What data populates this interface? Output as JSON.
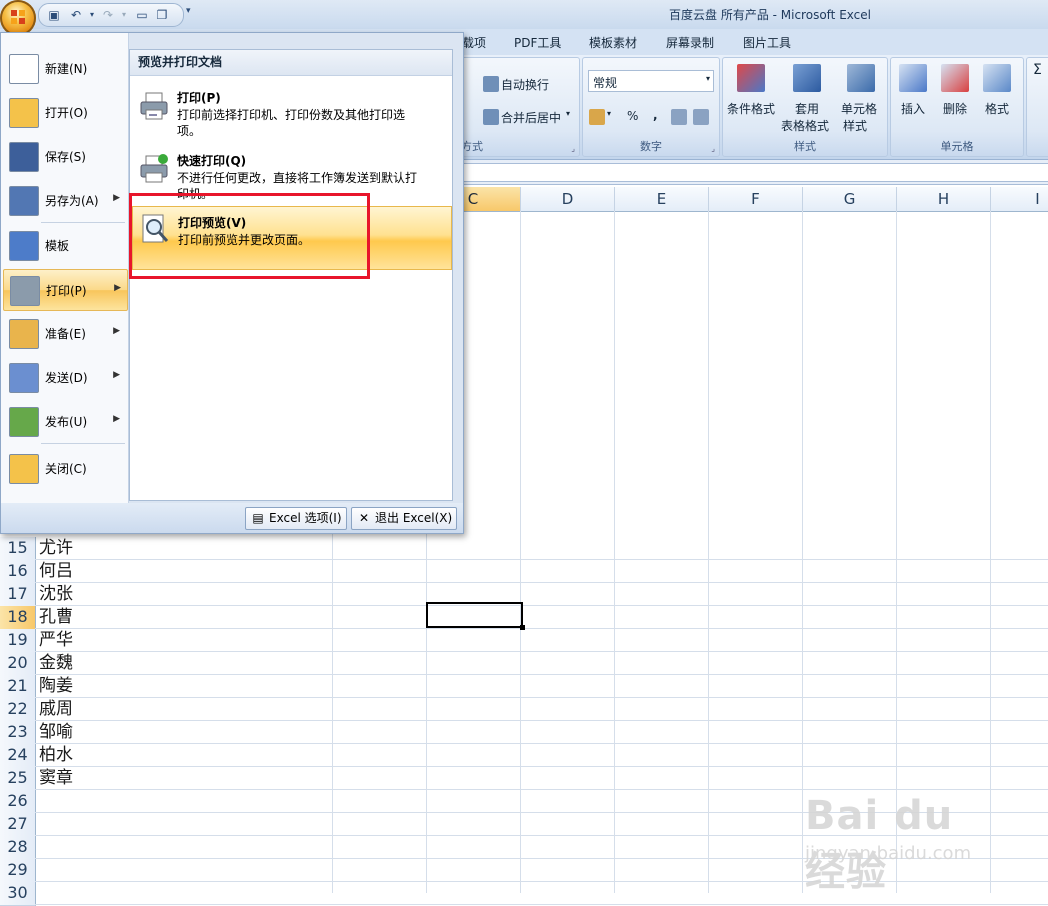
{
  "window": {
    "title": "百度云盘 所有产品 - Microsoft Excel"
  },
  "tabs": [
    "载项",
    "PDF工具",
    "模板素材",
    "屏幕录制",
    "图片工具"
  ],
  "ribbon": {
    "alignment": {
      "wrap_text": "自动换行",
      "merge_center": "合并后居中",
      "group_label": "方式"
    },
    "number": {
      "format_value": "常规",
      "percent": "%",
      "comma": ",",
      "group_label": "数字"
    },
    "styles": {
      "conditional": "条件格式",
      "table_fmt_1": "套用",
      "table_fmt_2": "表格格式",
      "cell_style_1": "单元格",
      "cell_style_2": "样式",
      "group_label": "样式"
    },
    "cells": {
      "insert": "插入",
      "delete": "删除",
      "format": "格式",
      "group_label": "单元格"
    }
  },
  "columns": [
    "C",
    "D",
    "E",
    "F",
    "G",
    "H",
    "I"
  ],
  "selected_column": "C",
  "rows": [
    {
      "num": "15",
      "name": "尤许"
    },
    {
      "num": "16",
      "name": "何吕"
    },
    {
      "num": "17",
      "name": "沈张"
    },
    {
      "num": "18",
      "name": "孔曹"
    },
    {
      "num": "19",
      "name": "严华"
    },
    {
      "num": "20",
      "name": "金魏"
    },
    {
      "num": "21",
      "name": "陶姜"
    },
    {
      "num": "22",
      "name": "戚周"
    },
    {
      "num": "23",
      "name": "邹喻"
    },
    {
      "num": "24",
      "name": "柏水"
    },
    {
      "num": "25",
      "name": "窦章"
    },
    {
      "num": "26",
      "name": ""
    },
    {
      "num": "27",
      "name": ""
    },
    {
      "num": "28",
      "name": ""
    },
    {
      "num": "29",
      "name": ""
    },
    {
      "num": "30",
      "name": ""
    }
  ],
  "selected_row": "18",
  "menu": {
    "items": [
      {
        "label": "新建(N)",
        "icon": "new-document-icon",
        "arrow": false
      },
      {
        "label": "打开(O)",
        "icon": "open-folder-icon",
        "arrow": false
      },
      {
        "label": "保存(S)",
        "icon": "save-disk-icon",
        "arrow": false
      },
      {
        "label": "另存为(A)",
        "icon": "save-as-icon",
        "arrow": true
      },
      {
        "label": "模板",
        "icon": "template-icon",
        "arrow": false
      },
      {
        "label": "打印(P)",
        "icon": "printer-icon",
        "arrow": true
      },
      {
        "label": "准备(E)",
        "icon": "prepare-pen-icon",
        "arrow": true
      },
      {
        "label": "发送(D)",
        "icon": "send-icon",
        "arrow": true
      },
      {
        "label": "发布(U)",
        "icon": "publish-icon",
        "arrow": true
      },
      {
        "label": "关闭(C)",
        "icon": "close-folder-icon",
        "arrow": false
      }
    ],
    "selected": "打印(P)",
    "submenu": {
      "header": "预览并打印文档",
      "items": [
        {
          "title": "打印(P)",
          "desc": "打印前选择打印机、打印份数及其他打印选项。",
          "icon": "printer-icon"
        },
        {
          "title": "快速打印(Q)",
          "desc": "不进行任何更改，直接将工作簿发送到默认打印机。",
          "icon": "quick-print-icon"
        },
        {
          "title": "打印预览(V)",
          "desc": "打印前预览并更改页面。",
          "icon": "print-preview-icon"
        }
      ]
    },
    "footer": {
      "options": "Excel 选项(I)",
      "exit": "退出 Excel(X)"
    }
  },
  "watermark": {
    "brand": "Bai du 经验",
    "url": "jingyan.baidu.com"
  },
  "colors": {
    "accent": "#f8c55b",
    "highlight_border": "#e8152b",
    "ribbon_bg": "#d3e1f2"
  }
}
